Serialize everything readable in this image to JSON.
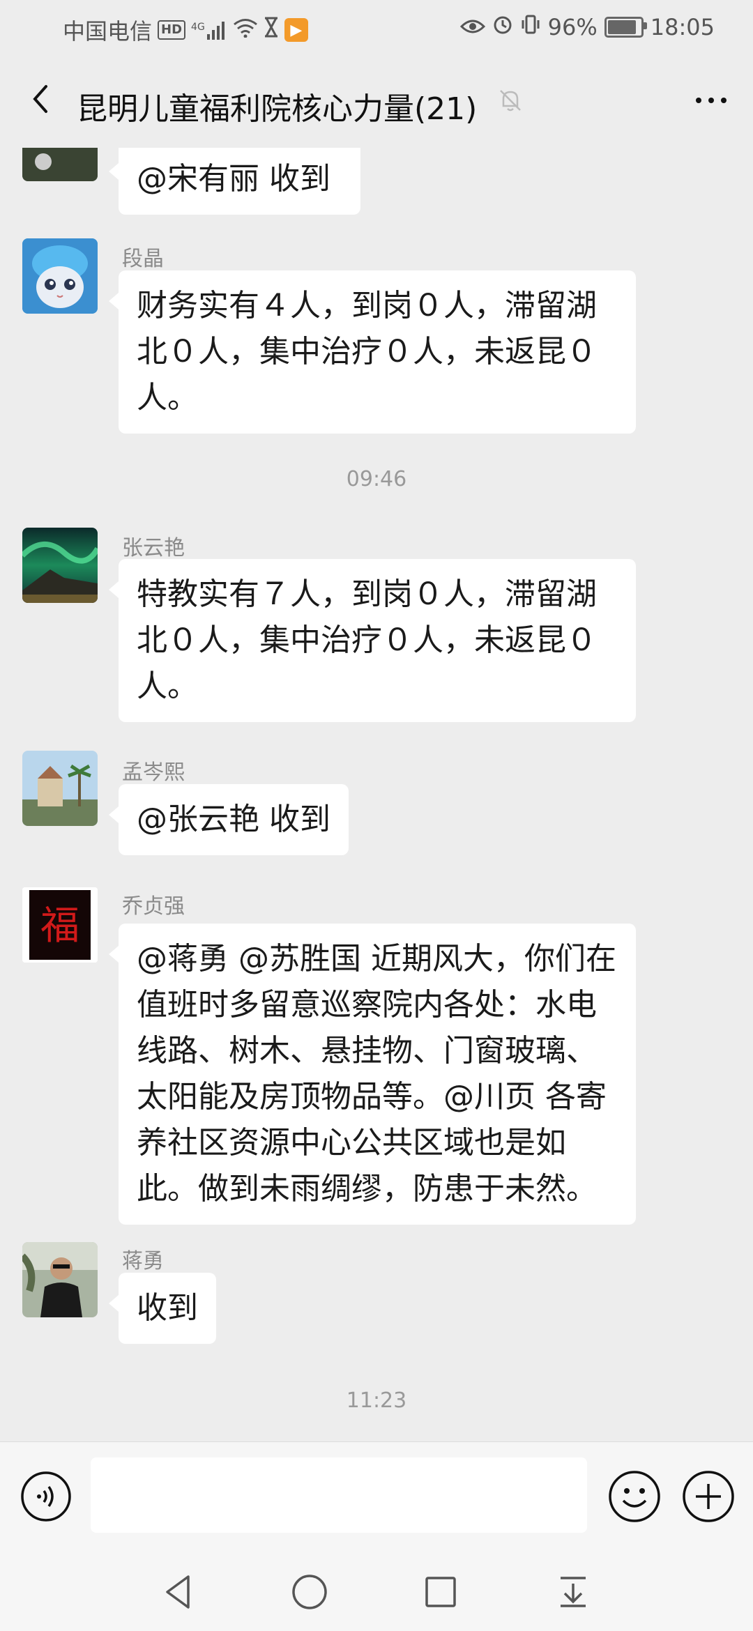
{
  "status_bar": {
    "carrier": "中国电信",
    "hd": "HD",
    "net": "4G",
    "battery_percent_text": "96%",
    "battery_level": 0.96,
    "time": "18:05"
  },
  "header": {
    "title": "昆明儿童福利院核心力量(21)",
    "icons": {
      "back": "chevron-left-icon",
      "mute": "bell-off-icon",
      "more": "more-dots-icon"
    }
  },
  "messages": [
    {
      "sender": "",
      "text": "@宋有丽  收到",
      "avatar": "avatar-partial"
    },
    {
      "sender": "段晶",
      "text": "财务实有４人，到岗０人，滞留湖北０人，集中治疗０人，未返昆０人。",
      "avatar": "avatar-cat"
    },
    {
      "time": "09:46"
    },
    {
      "sender": "张云艳",
      "text": "特教实有７人，到岗０人，滞留湖北０人，集中治疗０人，未返昆０人。",
      "avatar": "avatar-aurora"
    },
    {
      "sender": "孟岑熙",
      "text": "@张云艳 收到",
      "avatar": "avatar-palm"
    },
    {
      "sender": "乔贞强",
      "text": "@蒋勇 @苏胜国 近期风大，你们在值班时多留意巡察院内各处：水电线路、树木、悬挂物、门窗玻璃、太阳能及房顶物品等。@川页 各寄养社区资源中心公共区域也是如此。做到未雨绸缪，防患于未然。",
      "avatar": "avatar-fu"
    },
    {
      "sender": "蒋勇",
      "text": "收到",
      "avatar": "avatar-man"
    },
    {
      "time": "11:23"
    }
  ],
  "input_bar": {
    "text": "",
    "icons": {
      "voice": "voice-icon",
      "emoji": "emoji-icon",
      "plus": "plus-icon"
    }
  },
  "nav_bar": {
    "icons": [
      "back-triangle-icon",
      "home-circle-icon",
      "recent-square-icon",
      "notification-down-icon"
    ]
  }
}
